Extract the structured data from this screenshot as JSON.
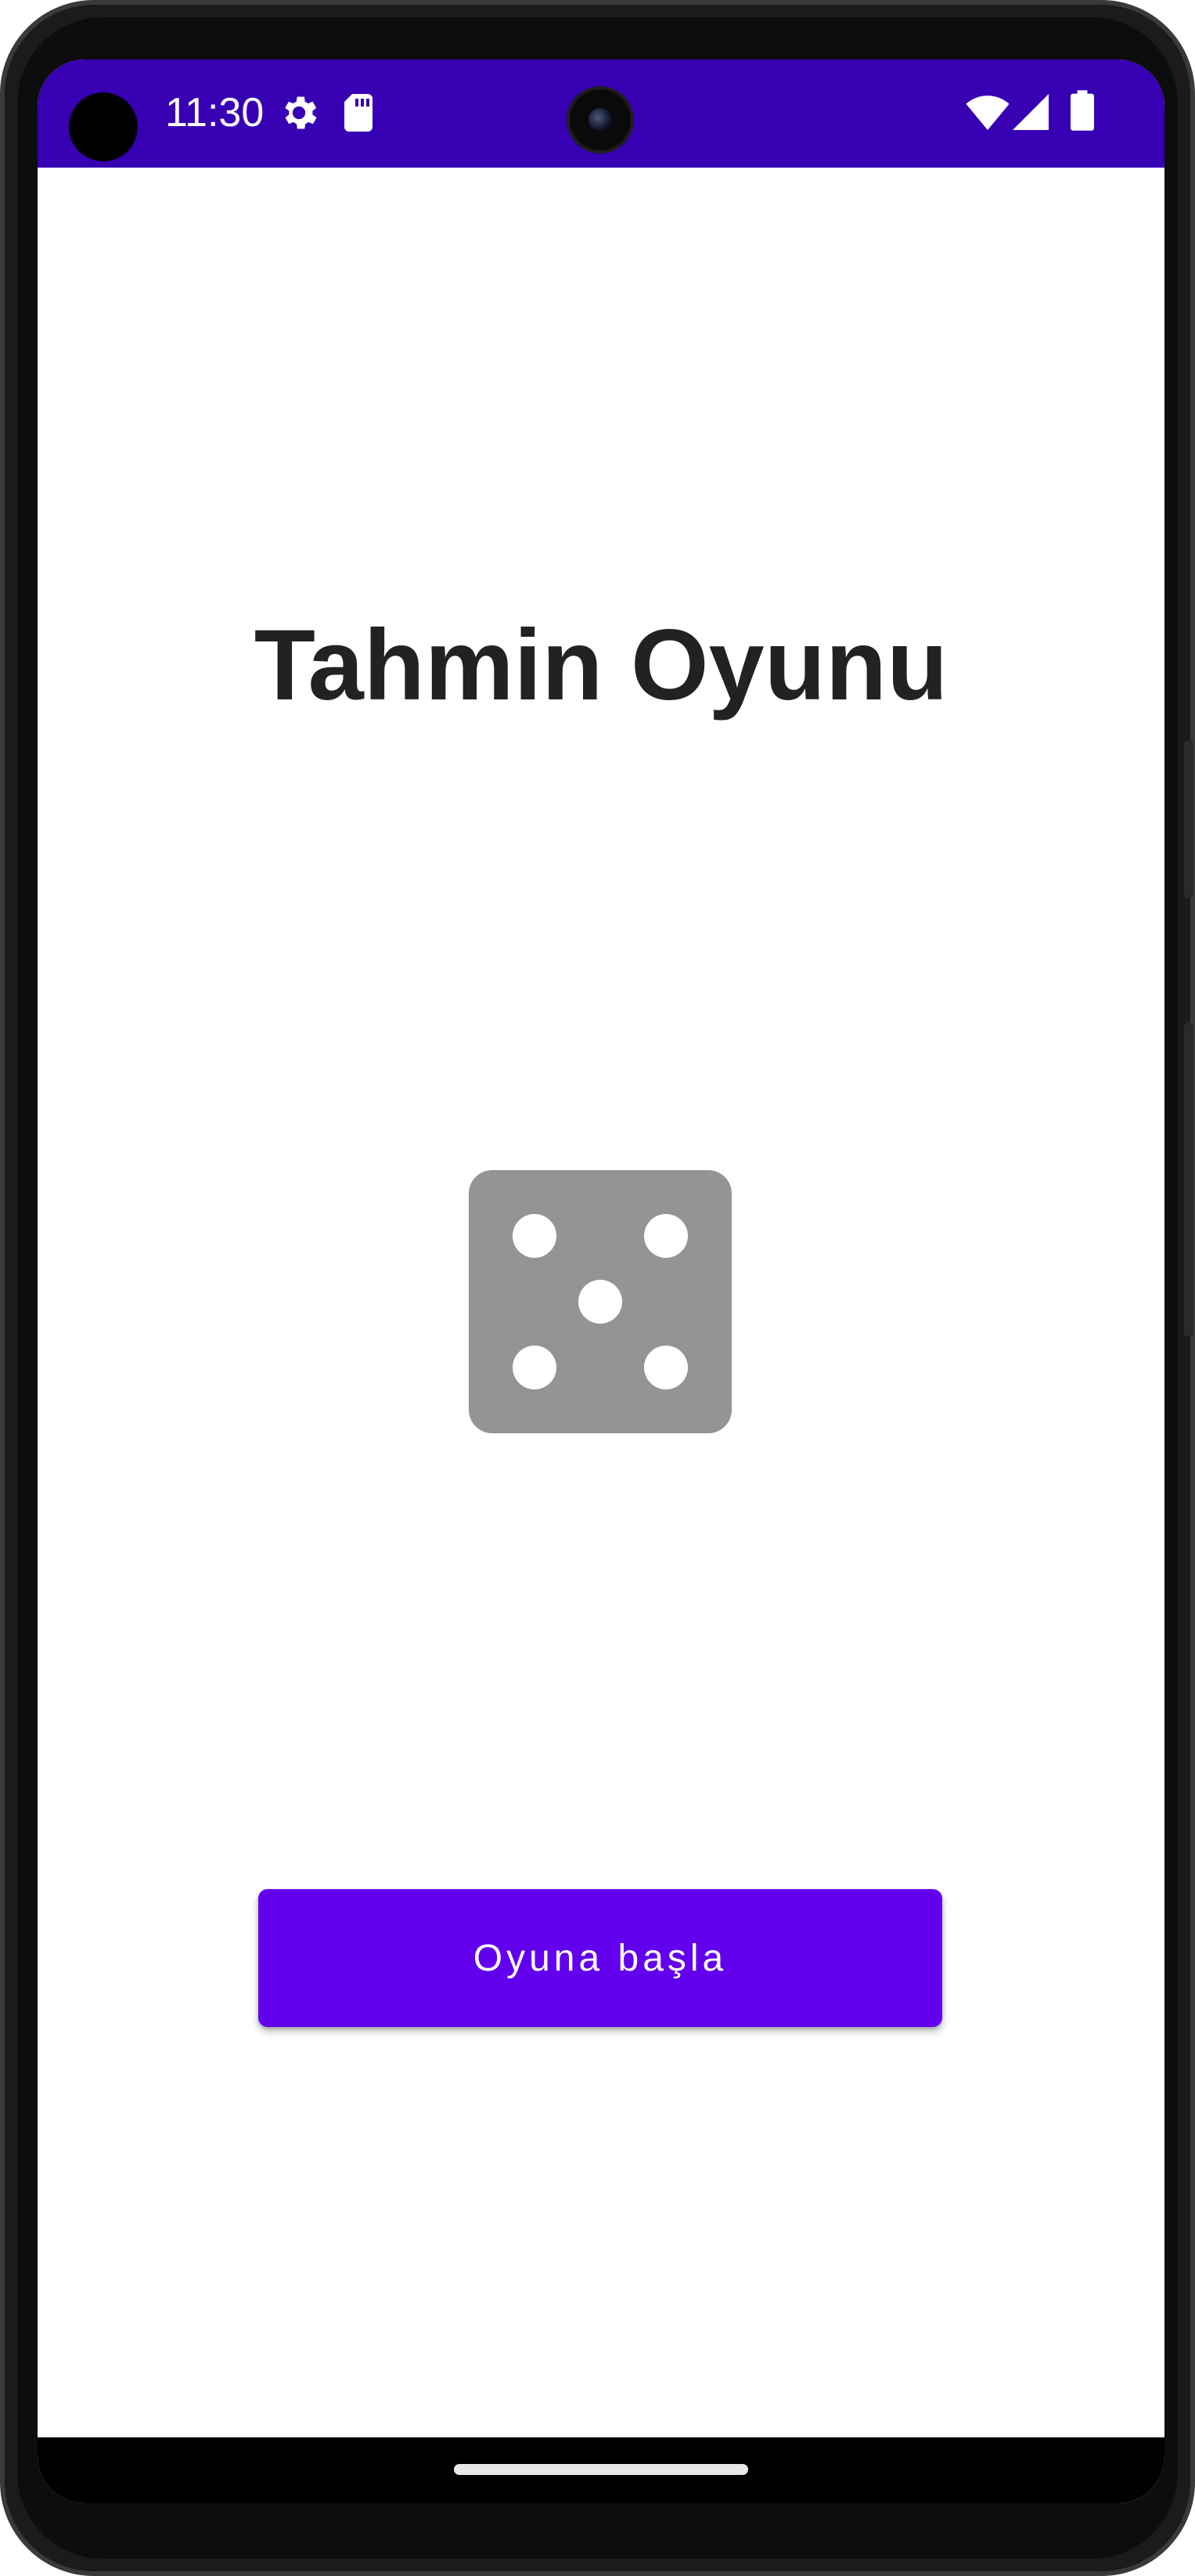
{
  "status_bar": {
    "time": "11:30",
    "background": "#3700b3",
    "icons": [
      "gear-icon",
      "sd-card-icon",
      "wifi-icon",
      "signal-icon",
      "battery-icon"
    ]
  },
  "main": {
    "title": "Tahmin Oyunu",
    "dice_icon": "dice-five-icon",
    "start_button_label": "Oyuna başla",
    "accent_color": "#6200ee"
  },
  "nav_bar": {
    "handle": "gesture-handle"
  }
}
